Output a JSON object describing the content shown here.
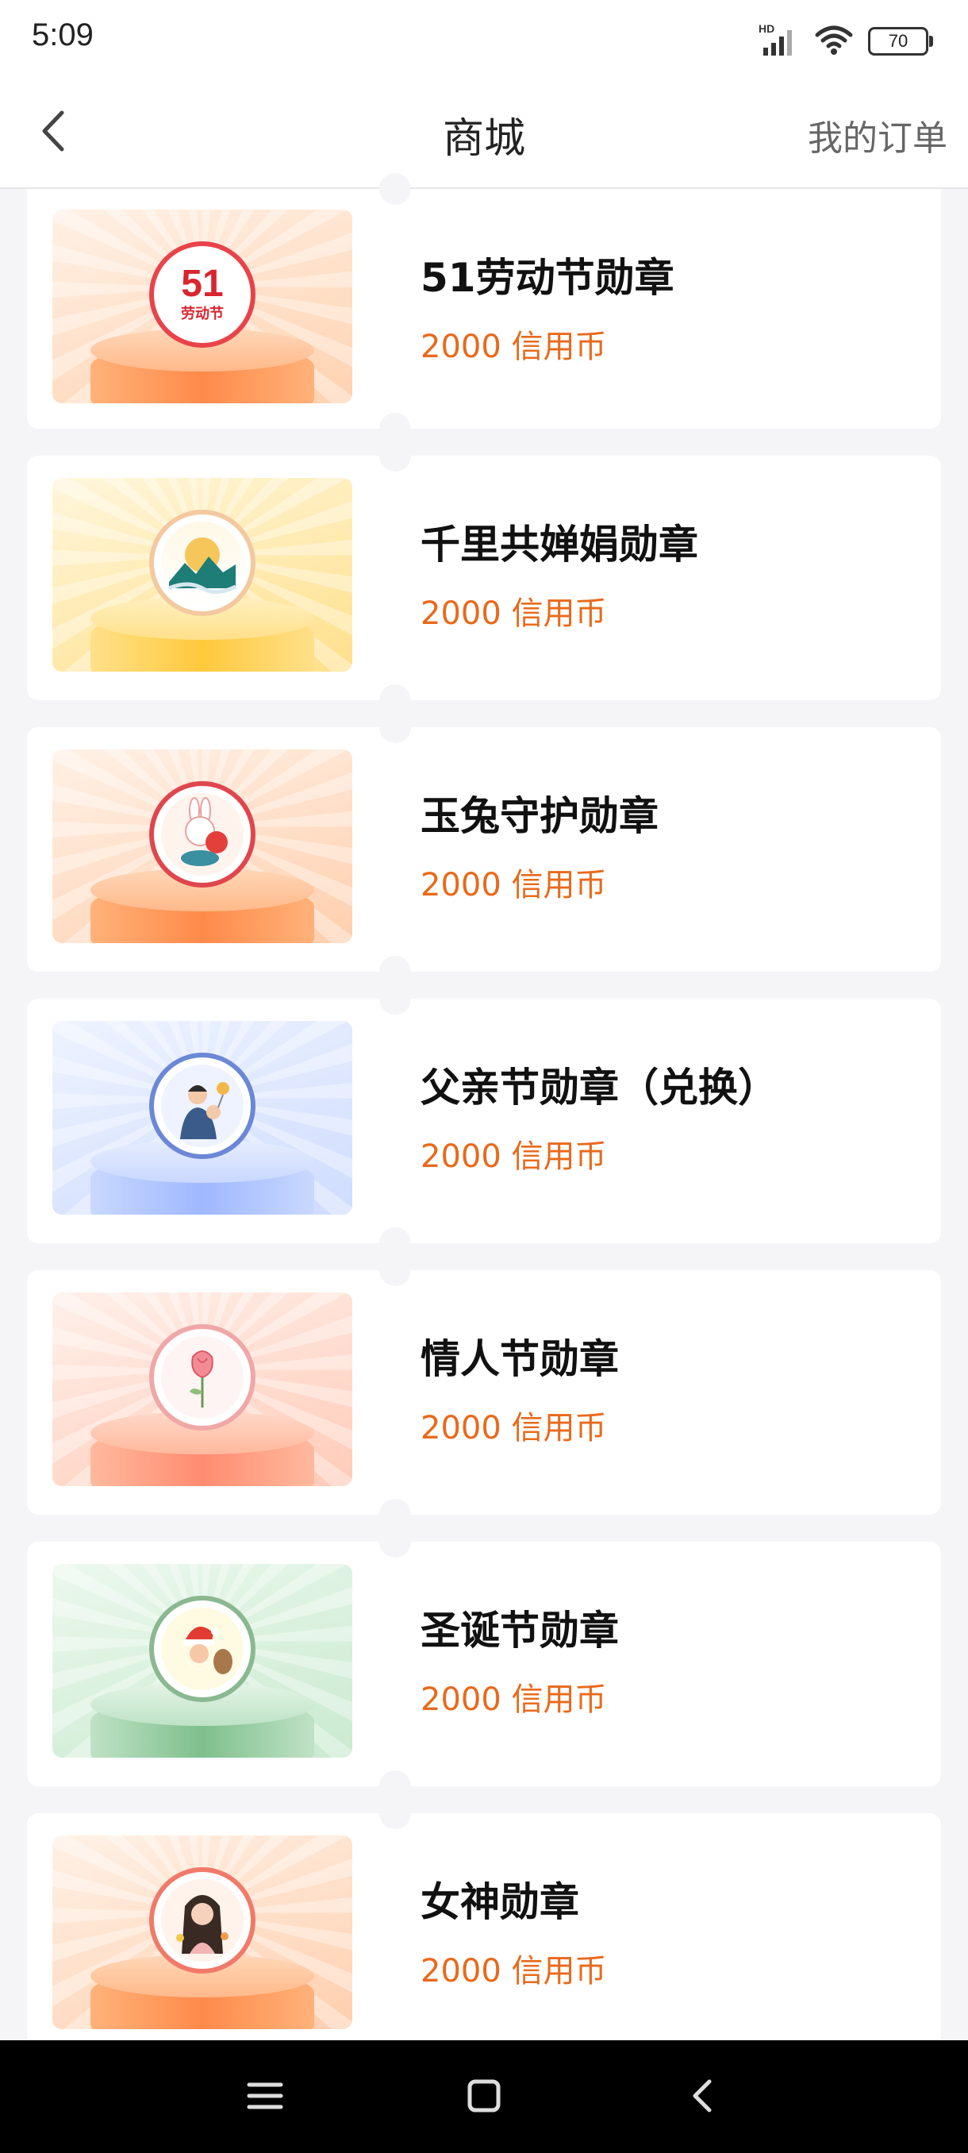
{
  "status": {
    "time": "5:09",
    "battery": "70",
    "network": "HD"
  },
  "nav": {
    "title": "商城",
    "orders": "我的订单"
  },
  "colors": {
    "price": "#e86a1c",
    "background": "#f5f5f7"
  },
  "items": [
    {
      "title": "51劳动节勋章",
      "price": "2000 信用币",
      "medal_text": "51",
      "medal_sub": "劳动节",
      "theme": "orange",
      "icon": "labor-day-medal-icon"
    },
    {
      "title": "千里共婵娟勋章",
      "price": "2000 信用币",
      "theme": "yellow",
      "icon": "moon-mountain-medal-icon"
    },
    {
      "title": "玉兔守护勋章",
      "price": "2000 信用币",
      "theme": "orange",
      "icon": "jade-rabbit-medal-icon"
    },
    {
      "title": "父亲节勋章（兑换）",
      "price": "2000 信用币",
      "theme": "blue",
      "icon": "father-child-medal-icon"
    },
    {
      "title": "情人节勋章",
      "price": "2000 信用币",
      "theme": "pink",
      "icon": "rose-medal-icon"
    },
    {
      "title": "圣诞节勋章",
      "price": "2000 信用币",
      "theme": "green",
      "icon": "santa-medal-icon"
    },
    {
      "title": "女神勋章",
      "price": "2000 信用币",
      "theme": "orange",
      "icon": "goddess-medal-icon"
    }
  ]
}
